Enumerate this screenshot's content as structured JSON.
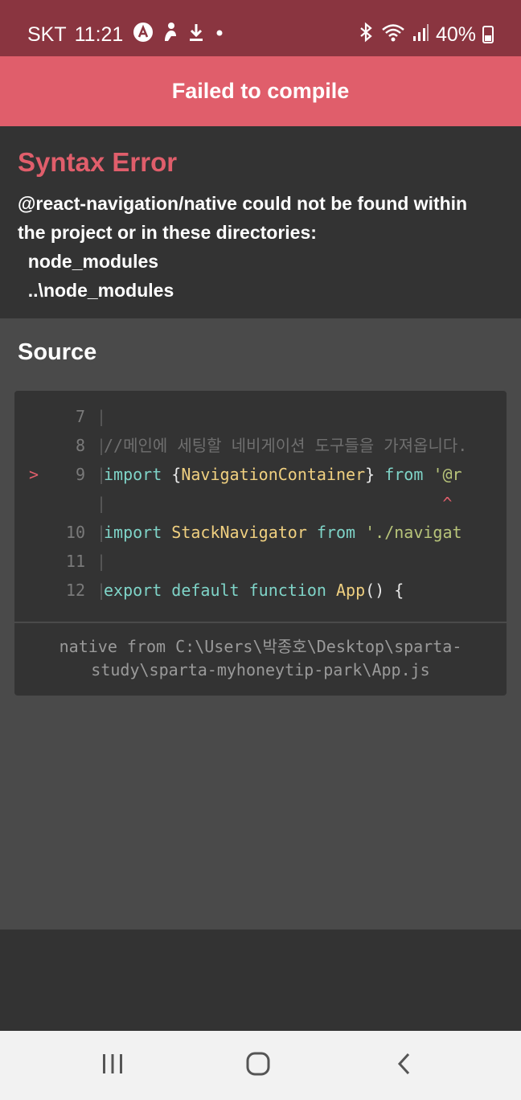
{
  "status_bar": {
    "carrier": "SKT",
    "time": "11:21",
    "battery": "40%",
    "icons": [
      "a-circle-icon",
      "person-icon",
      "download-icon",
      "dot-icon",
      "bluetooth-icon",
      "wifi-icon",
      "signal-icon",
      "battery-icon"
    ]
  },
  "header": {
    "title": "Failed to compile"
  },
  "error": {
    "title": "Syntax Error",
    "message": "@react-navigation/native could not be found within\nthe project or in these directories:\n  node_modules\n  ..\\node_modules"
  },
  "source": {
    "title": "Source",
    "lines": [
      {
        "marker": "",
        "number": "7",
        "code": ""
      },
      {
        "marker": "",
        "number": "8",
        "code": "//메인에 세팅할 네비게이션 도구들을 가져옵니다."
      },
      {
        "marker": ">",
        "number": "9",
        "code": "import {NavigationContainer} from '@r"
      },
      {
        "marker": "",
        "number": "",
        "code": "                                   ^"
      },
      {
        "marker": "",
        "number": "10",
        "code": "import StackNavigator from './navigat"
      },
      {
        "marker": "",
        "number": "11",
        "code": ""
      },
      {
        "marker": "",
        "number": "12",
        "code": "export default function App() {"
      }
    ],
    "file_path": "native from C:\\Users\\박종호\\Desktop\\sparta-\nstudy\\sparta-myhoneytip-park\\App.js"
  },
  "nav_bar": {
    "buttons": [
      "recent-apps",
      "home",
      "back"
    ]
  },
  "colors": {
    "status_bar_bg": "#8a3540",
    "header_bg": "#e05e6b",
    "error_title": "#e05e6b",
    "background": "#333333",
    "source_bg": "#4a4a4a",
    "keyword": "#7fd4c8",
    "identifier": "#f0d080",
    "string": "#b8c47a"
  }
}
